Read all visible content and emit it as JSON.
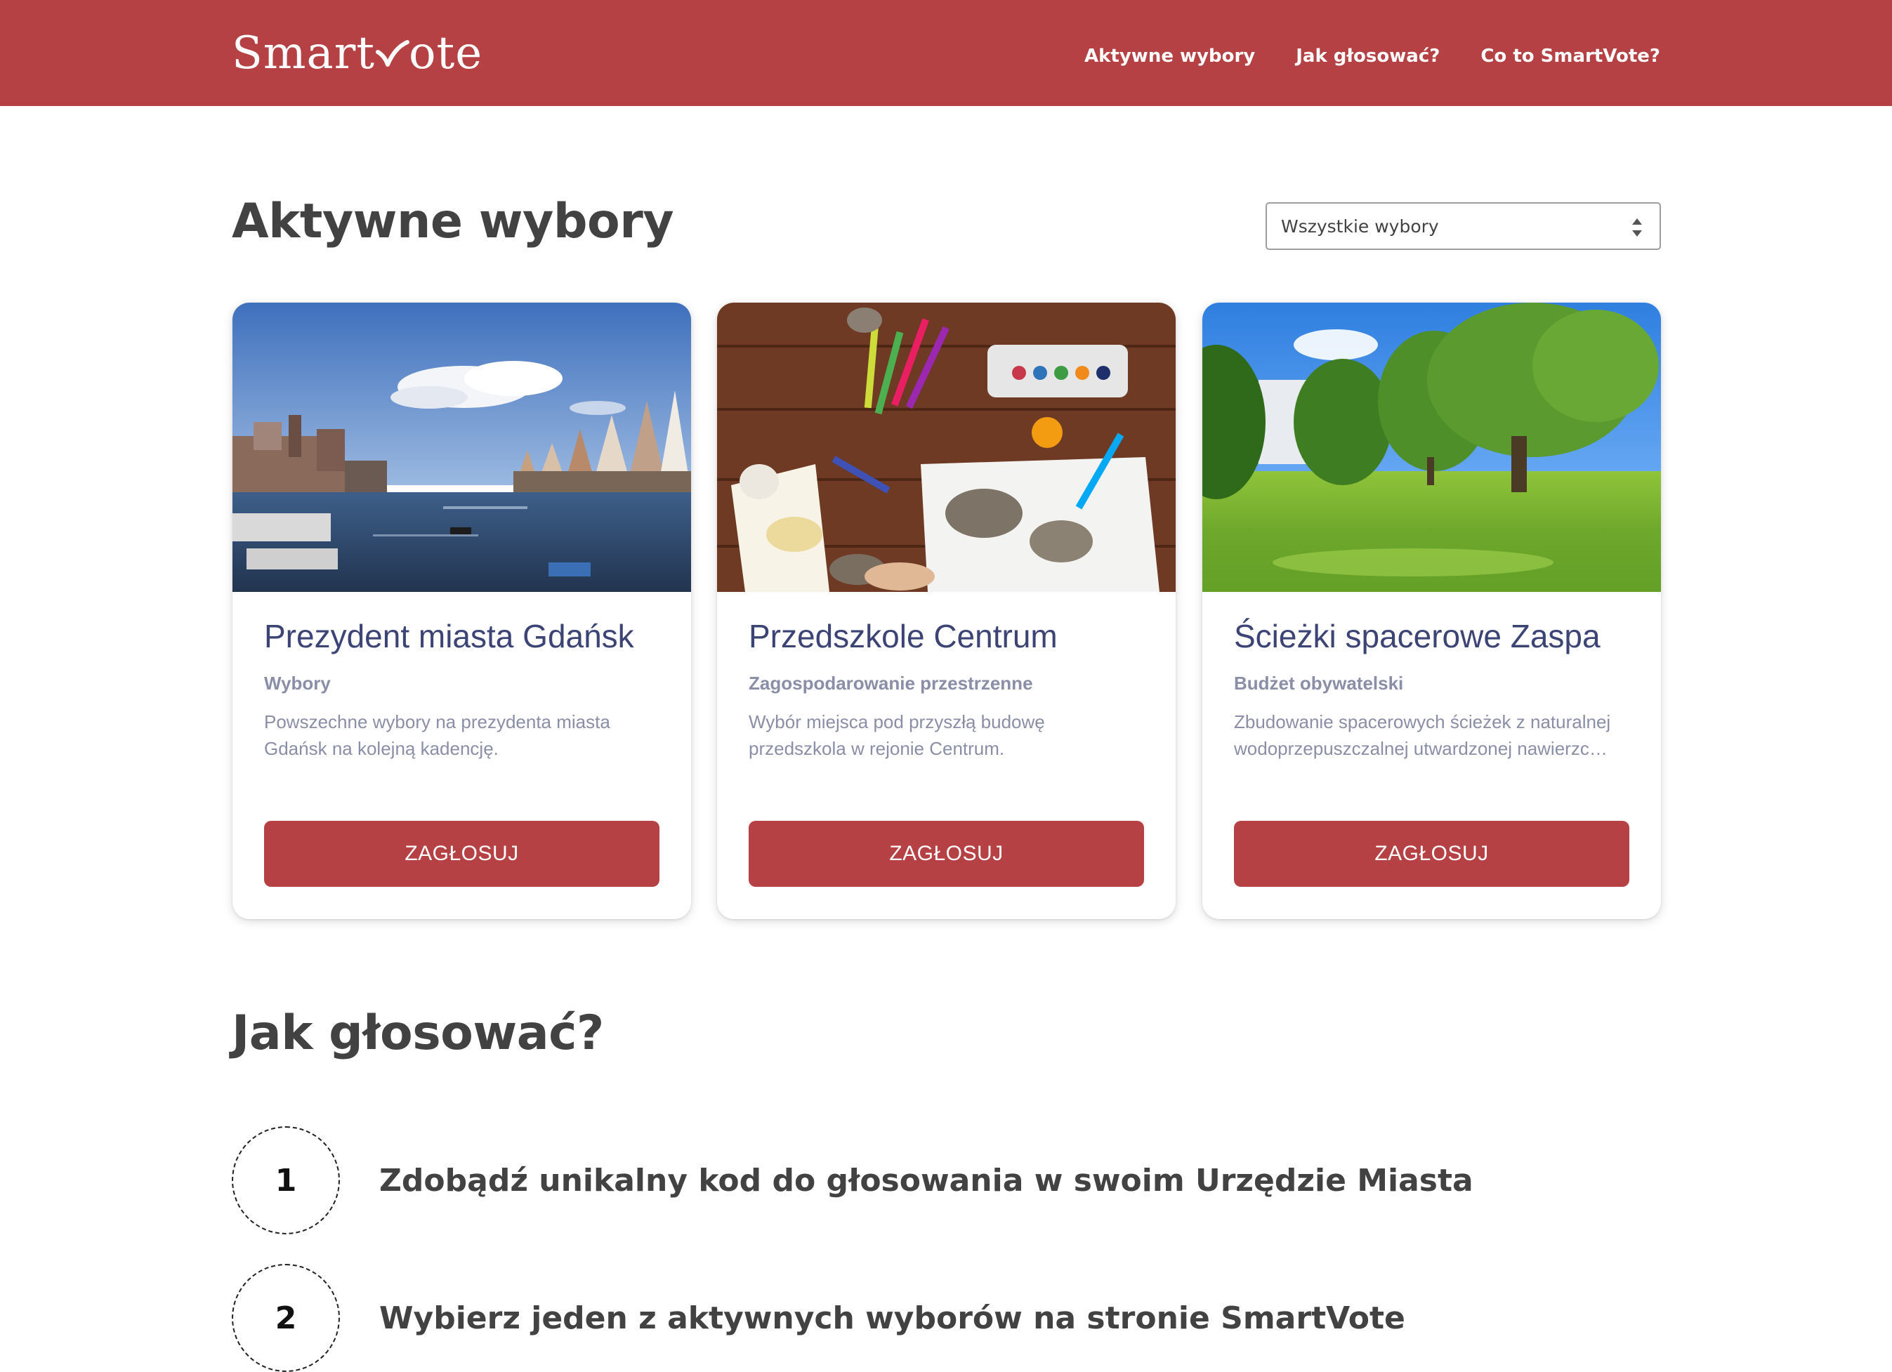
{
  "header": {
    "logo_text_left": "Smart",
    "logo_text_right": "ote",
    "nav": [
      "Aktywne wybory",
      "Jak głosować?",
      "Co to SmartVote?"
    ]
  },
  "active": {
    "title": "Aktywne wybory",
    "filter_value": "Wszystkie wybory"
  },
  "cards": [
    {
      "title": "Prezydent miasta Gdańsk",
      "category": "Wybory",
      "description": "Powszechne wybory na prezydenta miasta Gdańsk na kolejną kadencję.",
      "button": "ZAGŁOSUJ"
    },
    {
      "title": "Przedszkole Centrum",
      "category": "Zagospodarowanie przestrzenne",
      "description": "Wybór miejsca pod przyszłą budowę przedszkola w rejonie Centrum.",
      "button": "ZAGŁOSUJ"
    },
    {
      "title": "Ścieżki spacerowe Zaspa",
      "category": "Budżet obywatelski",
      "description": "Zbudowanie spacerowych ścieżek z naturalnej wodoprzepuszczalnej utwardzonej nawierzc…",
      "button": "ZAGŁOSUJ"
    }
  ],
  "howto": {
    "title": "Jak głosować?",
    "steps": [
      {
        "number": "1",
        "text": "Zdobądź unikalny kod do głosowania w swoim Urzędzie Miasta"
      },
      {
        "number": "2",
        "text": "Wybierz jeden z aktywnych wyborów na stronie SmartVote"
      }
    ]
  },
  "colors": {
    "brand": "#b54144",
    "card_title": "#3c4476",
    "muted": "#8a8ea6"
  }
}
